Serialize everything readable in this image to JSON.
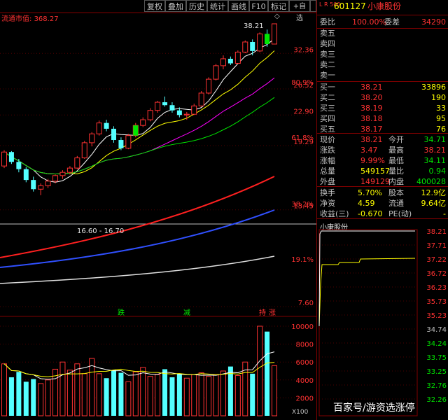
{
  "toolbar": {
    "buttons": [
      "复权",
      "叠加",
      "历史",
      "统计",
      "画线",
      "F10",
      "标记",
      "+自选",
      "返回"
    ]
  },
  "main_chart": {
    "market_cap_label": "流通市值:",
    "market_cap_value": "368.27",
    "high_label": "38.21",
    "low_label": "16.60 - 16.70",
    "price_ticks": [
      "32.36",
      "26.52",
      "22.90",
      "19.29",
      "13.45",
      "7.60"
    ],
    "pct_ticks": [
      "80.9%",
      "61.8%",
      "38.2%",
      "19.1%"
    ],
    "signals": [
      {
        "text": "跌",
        "color": "#00e600"
      },
      {
        "text": "减",
        "color": "#00e600"
      },
      {
        "text": "持",
        "color": "#ff3232"
      },
      {
        "text": "涨",
        "color": "#ff3232"
      }
    ]
  },
  "volume_chart": {
    "ticks": [
      "10000",
      "8000",
      "6000",
      "4000",
      "2000"
    ],
    "unit": "X100",
    "watermark": "百家号/游资选涨停"
  },
  "header": {
    "code_prefix": "L R 500",
    "code": "601127",
    "name": "小康股份"
  },
  "ratio": {
    "label1": "委比",
    "value1": "100.00%",
    "label2": "委差",
    "value2": "34290"
  },
  "asks": [
    {
      "label": "卖五"
    },
    {
      "label": "卖四"
    },
    {
      "label": "卖三"
    },
    {
      "label": "卖二"
    },
    {
      "label": "卖一"
    }
  ],
  "bids": [
    {
      "label": "买一",
      "price": "38.21",
      "vol": "33896"
    },
    {
      "label": "买二",
      "price": "38.20",
      "vol": "190"
    },
    {
      "label": "买三",
      "price": "38.19",
      "vol": "33"
    },
    {
      "label": "买四",
      "price": "38.18",
      "vol": "95"
    },
    {
      "label": "买五",
      "price": "38.17",
      "vol": "76"
    }
  ],
  "stats": [
    {
      "l1": "现价",
      "v1": "38.21",
      "c1": "red",
      "l2": "今开",
      "v2": "34.71",
      "c2": "green"
    },
    {
      "l1": "涨跌",
      "v1": "3.47",
      "c1": "red",
      "l2": "最高",
      "v2": "38.21",
      "c2": "red"
    },
    {
      "l1": "涨幅",
      "v1": "9.99%",
      "c1": "red",
      "l2": "最低",
      "v2": "34.11",
      "c2": "green"
    },
    {
      "l1": "总量",
      "v1": "549157",
      "c1": "yellow",
      "l2": "量比",
      "v2": "0.94",
      "c2": "green"
    },
    {
      "l1": "外盘",
      "v1": "149129",
      "c1": "red",
      "l2": "内盘",
      "v2": "400028",
      "c2": "green"
    }
  ],
  "stats2": [
    {
      "l1": "换手",
      "v1": "5.70%",
      "l2": "股本",
      "v2": "12.9亿"
    },
    {
      "l1": "净资",
      "v1": "4.59",
      "l2": "流通",
      "v2": "9.64亿"
    },
    {
      "l1": "收益(三)",
      "v1": "-0.670",
      "l2": "PE(动)",
      "v2": "-"
    }
  ],
  "mini": {
    "title": "小康股份",
    "ticks": [
      "38.21",
      "37.71",
      "37.22",
      "36.72",
      "36.23",
      "35.73",
      "35.23",
      "34.74",
      "34.24",
      "33.75",
      "33.25",
      "32.76",
      "32.26"
    ]
  },
  "chart_data": {
    "type": "candlestick",
    "candles": [
      [
        17.2,
        18.8,
        17.0,
        18.6
      ],
      [
        18.6,
        18.7,
        17.4,
        17.6
      ],
      [
        17.6,
        17.9,
        16.6,
        16.9
      ],
      [
        16.9,
        17.1,
        15.7,
        15.9
      ],
      [
        15.9,
        16.2,
        14.9,
        15.1
      ],
      [
        15.1,
        15.6,
        14.6,
        15.4
      ],
      [
        15.4,
        16.0,
        15.2,
        15.8
      ],
      [
        15.8,
        16.4,
        15.6,
        16.3
      ],
      [
        16.3,
        16.8,
        16.0,
        16.6
      ],
      [
        16.6,
        17.2,
        16.4,
        17.0
      ],
      [
        17.0,
        18.2,
        16.9,
        18.0
      ],
      [
        18.0,
        19.8,
        17.9,
        19.6
      ],
      [
        19.6,
        20.8,
        19.2,
        20.6
      ],
      [
        20.6,
        22.2,
        20.4,
        21.9
      ],
      [
        21.9,
        22.3,
        20.9,
        21.2
      ],
      [
        21.2,
        21.5,
        19.6,
        19.9
      ],
      [
        19.9,
        20.2,
        18.8,
        19.0
      ],
      [
        19.0,
        20.6,
        18.9,
        20.4
      ],
      [
        20.4,
        21.9,
        20.2,
        21.6
      ],
      [
        21.6,
        22.6,
        21.4,
        22.3
      ],
      [
        22.3,
        23.8,
        22.1,
        23.5
      ],
      [
        23.5,
        24.8,
        23.2,
        24.6
      ],
      [
        24.6,
        25.4,
        24.0,
        24.2
      ],
      [
        24.2,
        24.6,
        23.2,
        23.5
      ],
      [
        23.5,
        23.9,
        22.6,
        22.9
      ],
      [
        22.9,
        23.3,
        22.3,
        23.0
      ],
      [
        23.0,
        24.4,
        22.9,
        24.1
      ],
      [
        24.1,
        26.2,
        24.0,
        25.9
      ],
      [
        25.9,
        28.3,
        25.7,
        28.0
      ],
      [
        28.0,
        30.5,
        27.8,
        30.2
      ],
      [
        30.2,
        32.0,
        29.6,
        31.4
      ],
      [
        31.4,
        31.8,
        30.3,
        30.6
      ],
      [
        30.6,
        32.9,
        30.5,
        32.6
      ],
      [
        32.6,
        34.8,
        32.4,
        34.5
      ],
      [
        34.5,
        35.0,
        32.0,
        32.8
      ],
      [
        32.8,
        36.4,
        32.6,
        36.1
      ],
      [
        36.1,
        37.0,
        33.6,
        34.1
      ],
      [
        34.1,
        38.21,
        34.1,
        38.21
      ]
    ],
    "volumes": [
      5800,
      4300,
      4900,
      3800,
      4100,
      3600,
      4000,
      5200,
      6000,
      5100,
      5800,
      4700,
      6400,
      4700,
      4200,
      5100,
      4800,
      3800,
      4900,
      5400,
      4400,
      4600,
      5200,
      4300,
      4700,
      4200,
      4600,
      4800,
      4400,
      4600,
      5000,
      5500,
      4500,
      6000,
      4700,
      10000,
      9400,
      5600
    ],
    "price_range": [
      7.6,
      38.21
    ]
  }
}
